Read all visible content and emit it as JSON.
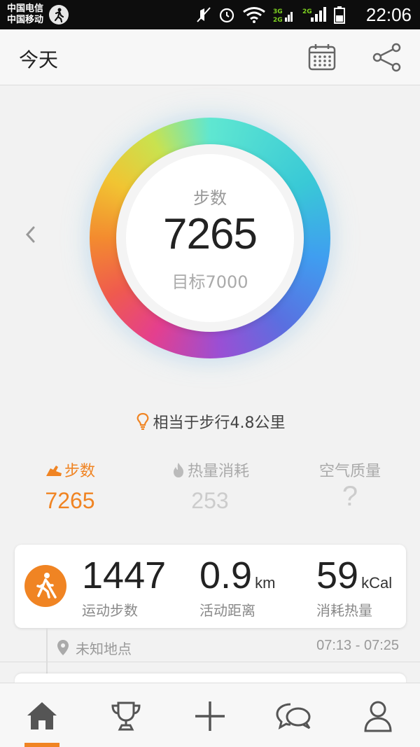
{
  "status_bar": {
    "carrier_1": "中国电信",
    "carrier_2": "中国移动",
    "time": "22:06",
    "icons": [
      "sport-notification-icon",
      "mute-icon",
      "alarm-icon",
      "wifi-icon",
      "signal-3g-icon",
      "signal-2g-icon",
      "battery-icon"
    ]
  },
  "header": {
    "title": "今天",
    "icons": [
      "calendar-icon",
      "share-icon"
    ]
  },
  "ring": {
    "label": "步数",
    "value": "7265",
    "goal": "目标7000",
    "progress": 1.0
  },
  "hint": "相当于步行4.8公里",
  "tabs": [
    {
      "label": "步数",
      "value": "7265",
      "icon": "shoe-icon",
      "active": true
    },
    {
      "label": "热量消耗",
      "value": "253",
      "icon": "flame-icon",
      "active": false
    },
    {
      "label": "空气质量",
      "value": "?",
      "active": false
    }
  ],
  "activity": {
    "icon": "walking-icon",
    "steps_value": "1447",
    "steps_label": "运动步数",
    "distance_value": "0.9",
    "distance_unit": "km",
    "distance_label": "活动距离",
    "calories_value": "59",
    "calories_unit": "kCal",
    "calories_label": "消耗热量",
    "location": "未知地点",
    "time_range": "07:13 - 07:25"
  },
  "bottom_nav": {
    "items": [
      "home-icon",
      "trophy-icon",
      "add-icon",
      "chat-icon",
      "profile-icon"
    ],
    "active": "home-icon"
  },
  "colors": {
    "accent": "#f08423"
  }
}
